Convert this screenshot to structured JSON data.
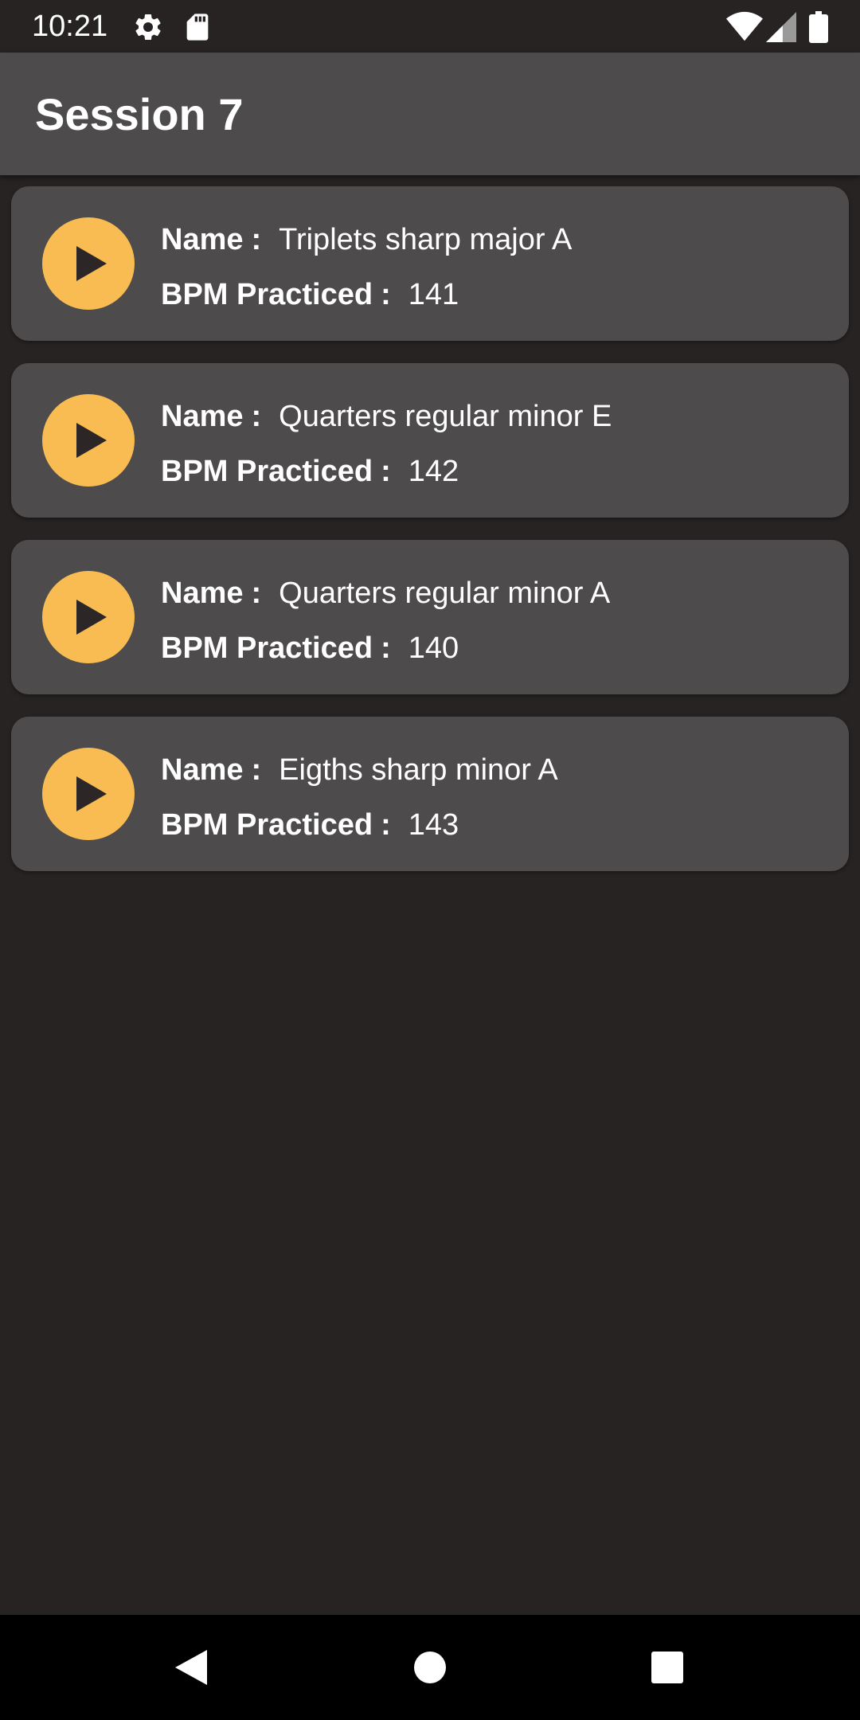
{
  "status_bar": {
    "time": "10:21",
    "icons": [
      "gear-icon",
      "sd-card-icon",
      "wifi-icon",
      "cell-signal-icon",
      "battery-icon"
    ]
  },
  "app_bar": {
    "title": "Session 7"
  },
  "colors": {
    "background": "#262322",
    "surface": "#4d4b4c",
    "accent": "#f8bc52",
    "text": "#ffffff",
    "nav_background": "#000000"
  },
  "labels": {
    "name": "Name",
    "bpm": "BPM Practiced",
    "separator": ":"
  },
  "items": [
    {
      "name": "Triplets sharp major A",
      "bpm": "141"
    },
    {
      "name": "Quarters regular minor E",
      "bpm": "142"
    },
    {
      "name": "Quarters regular minor A",
      "bpm": "140"
    },
    {
      "name": "Eigths sharp minor A",
      "bpm": "143"
    }
  ],
  "nav_bar": {
    "icons": [
      "back-icon",
      "home-icon",
      "recents-icon"
    ]
  }
}
